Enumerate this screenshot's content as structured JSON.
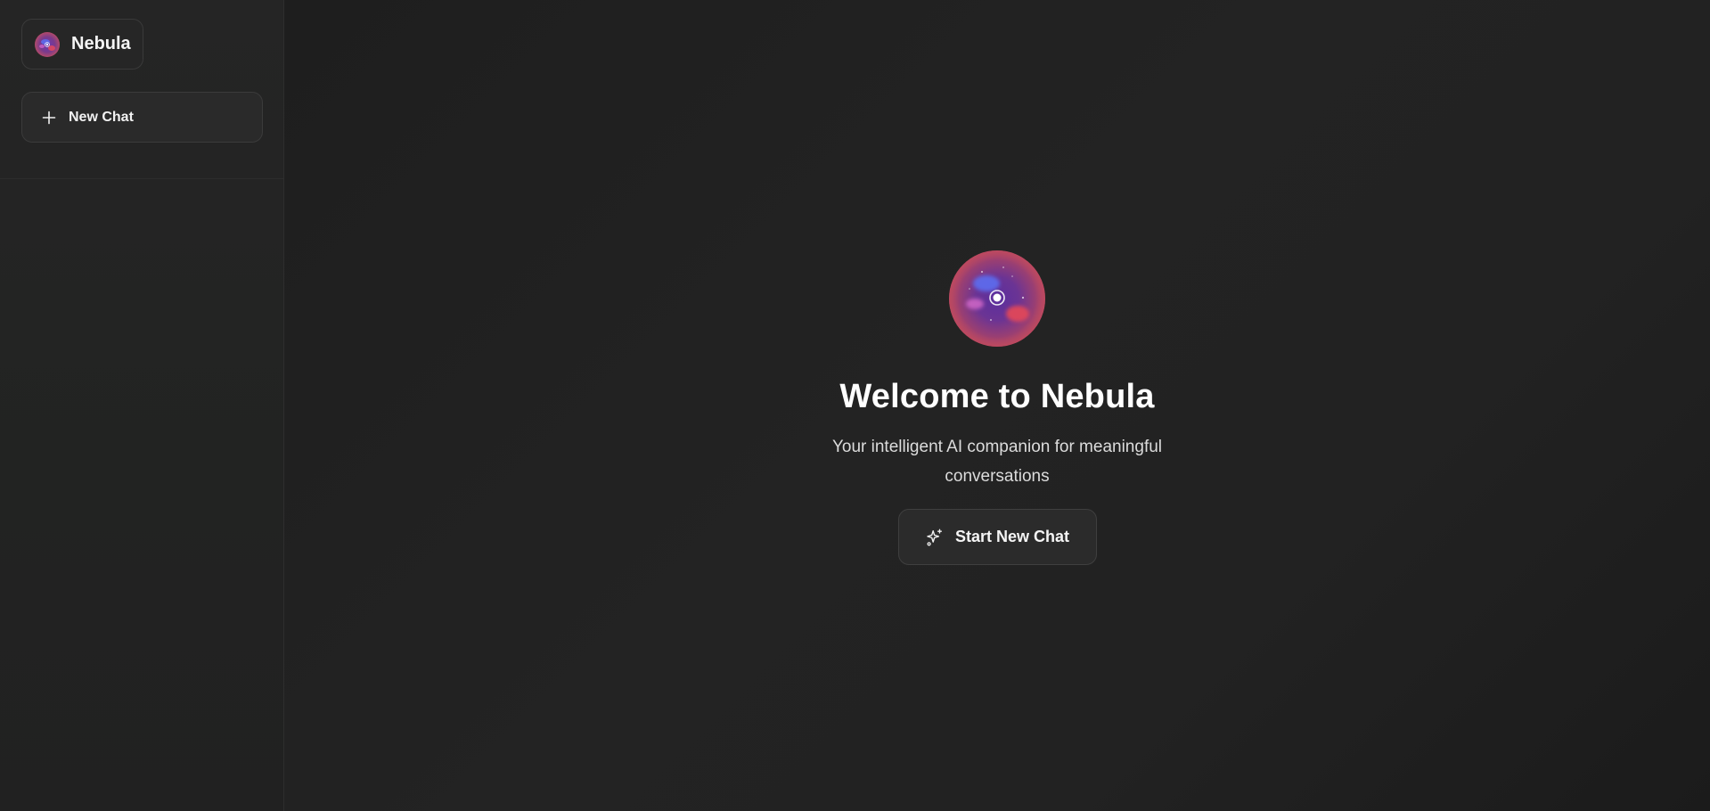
{
  "app": {
    "name": "Nebula"
  },
  "sidebar": {
    "new_chat_label": "New Chat",
    "plus_icon": "plus-icon"
  },
  "main": {
    "title": "Welcome to Nebula",
    "subtitle": "Your intelligent AI companion for meaningful conversations",
    "start_button_label": "Start New Chat",
    "start_button_icon": "sparkles-icon",
    "logo_icon": "nebula-orb-icon"
  },
  "colors": {
    "background": "#1f1f1f",
    "sidebar": "#232323",
    "button": "#2a2a2a",
    "border": "#3b3b3b",
    "orb_red": "#e0465a",
    "orb_blue": "#5d6df0",
    "orb_violet": "#7a3a9a"
  }
}
